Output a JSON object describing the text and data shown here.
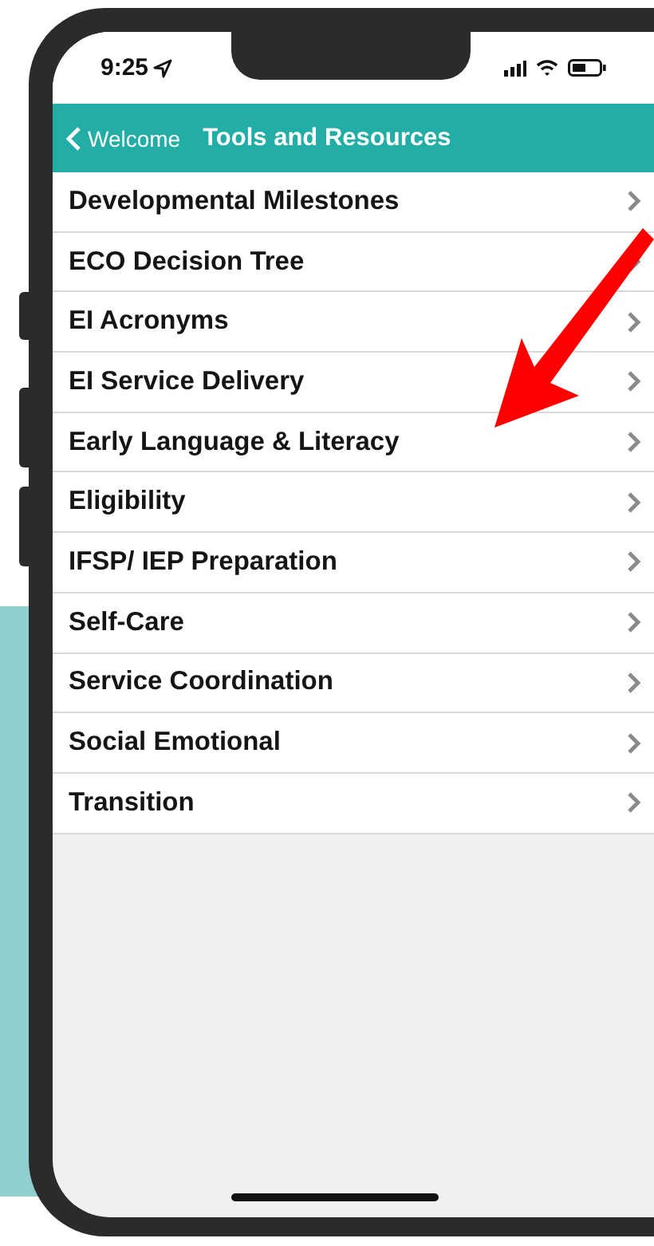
{
  "status_bar": {
    "time": "9:25"
  },
  "nav_bar": {
    "back": "Welcome",
    "title": "Tools and Resources"
  },
  "items": [
    {
      "label": "Developmental Milestones"
    },
    {
      "label": "ECO Decision Tree"
    },
    {
      "label": "EI Acronyms"
    },
    {
      "label": "EI Service Delivery"
    },
    {
      "label": "Early Language & Literacy"
    },
    {
      "label": "Eligibility"
    },
    {
      "label": "IFSP/ IEP Preparation"
    },
    {
      "label": "Self-Care"
    },
    {
      "label": "Service Coordination"
    },
    {
      "label": "Social Emotional"
    },
    {
      "label": "Transition"
    }
  ]
}
